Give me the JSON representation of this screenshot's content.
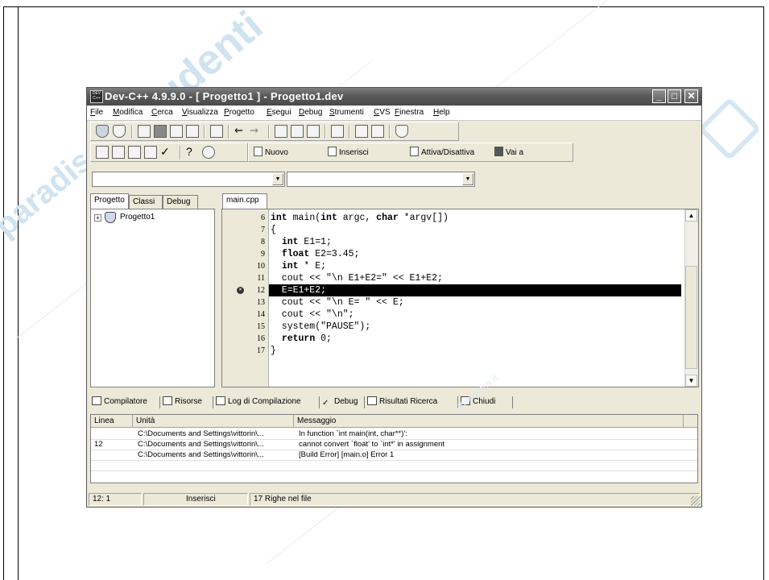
{
  "window": {
    "title": "Dev-C++ 4.9.9.0  - [ Progetto1 ] - Progetto1.dev",
    "app_icon_text": "DEV C++",
    "minimize": "_",
    "maximize": "□",
    "close": "✕"
  },
  "menu": [
    "File",
    "Modifica",
    "Cerca",
    "Visualizza",
    "Progetto",
    "Esegui",
    "Debug",
    "Strumenti",
    "CVS",
    "Finestra",
    "Help"
  ],
  "toolbar3": {
    "nuovo": "Nuovo",
    "inserisci": "Inserisci",
    "attiva": "Attiva/Disattiva",
    "vai": "Vai a"
  },
  "left_tabs": [
    "Progetto",
    "Classi",
    "Debug"
  ],
  "project_tree": {
    "root": "Progetto1",
    "expand": "+"
  },
  "editor_tab": "main.cpp",
  "code": [
    {
      "n": "6",
      "t": "int main(int argc, char *argv[])"
    },
    {
      "n": "7",
      "t": "{"
    },
    {
      "n": "8",
      "t": "  int E1=1;"
    },
    {
      "n": "9",
      "t": "  float E2=3.45;"
    },
    {
      "n": "10",
      "t": "  int * E;"
    },
    {
      "n": "11",
      "t": "  cout << \"\\n E1+E2=\" << E1+E2;"
    },
    {
      "n": "12",
      "t": "  E=E1+E2;"
    },
    {
      "n": "13",
      "t": "  cout << \"\\n E= \" << E;"
    },
    {
      "n": "14",
      "t": "  cout << \"\\n\";"
    },
    {
      "n": "15",
      "t": "  system(\"PAUSE\");"
    },
    {
      "n": "16",
      "t": "  return 0;"
    },
    {
      "n": "17",
      "t": "}"
    }
  ],
  "error_line": "12",
  "bottom_tabs": [
    "Compilatore",
    "Risorse",
    "Log di Compilazione",
    "Debug",
    "Risultati Ricerca",
    "Chiudi"
  ],
  "messages": {
    "headers": [
      "Linea",
      "Unità",
      "Messaggio"
    ],
    "rows": [
      {
        "linea": "",
        "unita": "C:\\Documents and Settings\\vittorin\\...",
        "messaggio": "In function `int main(int, char**)':"
      },
      {
        "linea": "12",
        "unita": "C:\\Documents and Settings\\vittorin\\...",
        "messaggio": "cannot convert `float' to `int*' in assignment"
      },
      {
        "linea": "",
        "unita": "C:\\Documents and Settings\\vittorin\\...",
        "messaggio": "[Build Error]  [main.o] Error 1"
      }
    ]
  },
  "status": {
    "position": "12: 1",
    "mode": "Inserisci",
    "lines": "17 Righe nel file"
  },
  "watermarks": {
    "main": "studenti",
    "side": "paradiso",
    "site": "www.docs.it"
  }
}
